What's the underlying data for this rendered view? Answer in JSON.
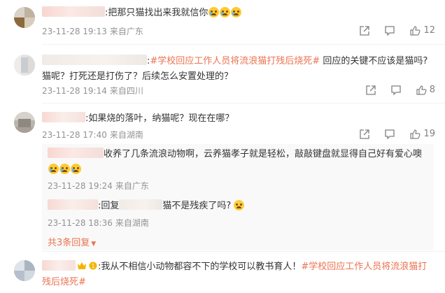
{
  "comments": [
    {
      "colon_text": ":",
      "text": "把那只猫找出来我就信你",
      "emoji_count": 3,
      "time": "23-11-28 19:13",
      "location": "来自广东",
      "likes": "12"
    },
    {
      "colon_text": ":",
      "topic": "#学校回应工作人员将流浪猫打残后烧死#",
      "text_line1": " 回应的关键不应该是猫吗?",
      "text_line2": "猫呢？打死还是打伤了？后续怎么安置处理的？",
      "time": "23-11-28 19:14",
      "location": "来自四川",
      "likes": "8"
    },
    {
      "colon_text": ":",
      "text": "如果烧的落叶，纳猫呢？现在在哪？",
      "time": "23-11-28 17:40",
      "location": "来自湖南",
      "likes": "19",
      "replies": [
        {
          "text": "收养了几条流浪动物啊，云养猫孝子就是轻松，敲敲键盘就显得自己好有爱心噢",
          "time": "23-11-28 19:24",
          "location": "来自广东"
        },
        {
          "prefix": ":回复",
          "text": "猫不是残疾了吗?",
          "time": "23-11-28 18:36",
          "location": "来自湖南"
        }
      ],
      "more_replies": "共3条回复"
    },
    {
      "colon_text": ":",
      "text": "我从不相信小动物都容不下的学校可以教书育人！",
      "topic_line1": "#学校回应工作人员将流浪猫打",
      "topic_line2": "残后烧死#"
    }
  ]
}
